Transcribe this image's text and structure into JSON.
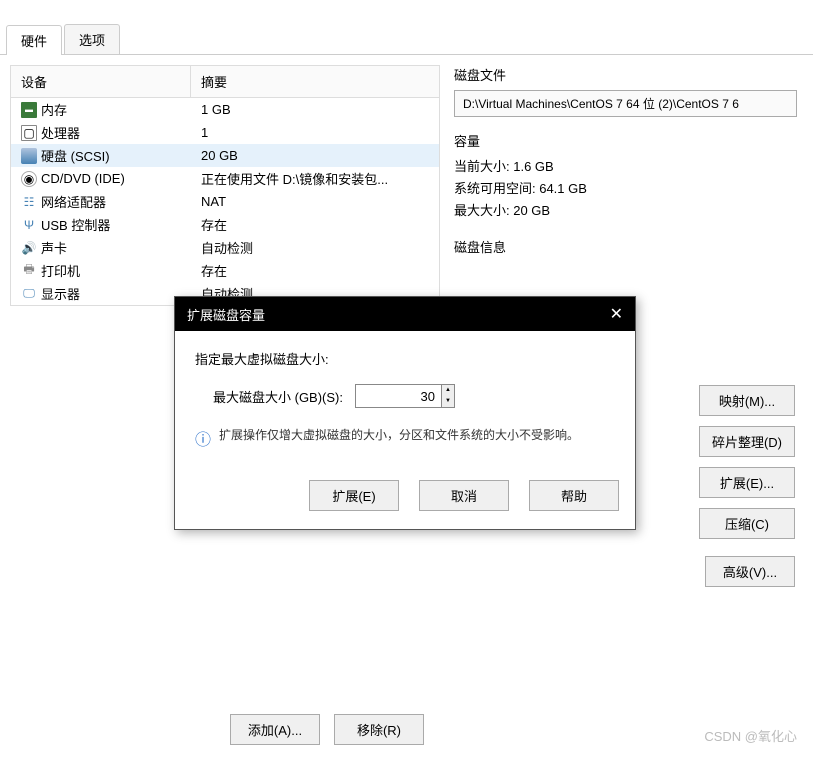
{
  "tabs": {
    "hardware": "硬件",
    "options": "选项"
  },
  "table": {
    "header_device": "设备",
    "header_summary": "摘要",
    "rows": [
      {
        "icon": "memory",
        "name": "内存",
        "summary": "1 GB"
      },
      {
        "icon": "cpu",
        "name": "处理器",
        "summary": "1"
      },
      {
        "icon": "disk",
        "name": "硬盘 (SCSI)",
        "summary": "20 GB",
        "selected": true
      },
      {
        "icon": "cd",
        "name": "CD/DVD (IDE)",
        "summary": "正在使用文件 D:\\镜像和安装包..."
      },
      {
        "icon": "net",
        "name": "网络适配器",
        "summary": "NAT"
      },
      {
        "icon": "usb",
        "name": "USB 控制器",
        "summary": "存在"
      },
      {
        "icon": "sound",
        "name": "声卡",
        "summary": "自动检测"
      },
      {
        "icon": "printer",
        "name": "打印机",
        "summary": "存在"
      },
      {
        "icon": "display",
        "name": "显示器",
        "summary": "自动检测"
      }
    ]
  },
  "right": {
    "disk_file_label": "磁盘文件",
    "disk_file_path": "D:\\Virtual Machines\\CentOS 7 64 位 (2)\\CentOS 7 6",
    "capacity_label": "容量",
    "current_size": "当前大小: 1.6 GB",
    "free_space": "系统可用空间: 64.1 GB",
    "max_size": "最大大小: 20 GB",
    "disk_info_label": "磁盘信息",
    "buttons": {
      "map": "映射(M)...",
      "defrag": "碎片整理(D)",
      "expand": "扩展(E)...",
      "compact": "压缩(C)",
      "advanced": "高级(V)..."
    }
  },
  "dialog": {
    "title": "扩展磁盘容量",
    "label": "指定最大虚拟磁盘大小:",
    "size_label": "最大磁盘大小 (GB)(S):",
    "size_value": "30",
    "info": "扩展操作仅增大虚拟磁盘的大小，分区和文件系统的大小不受影响。",
    "btn_expand": "扩展(E)",
    "btn_cancel": "取消",
    "btn_help": "帮助"
  },
  "bottom": {
    "add": "添加(A)...",
    "remove": "移除(R)"
  },
  "watermark": "CSDN @氧化心"
}
